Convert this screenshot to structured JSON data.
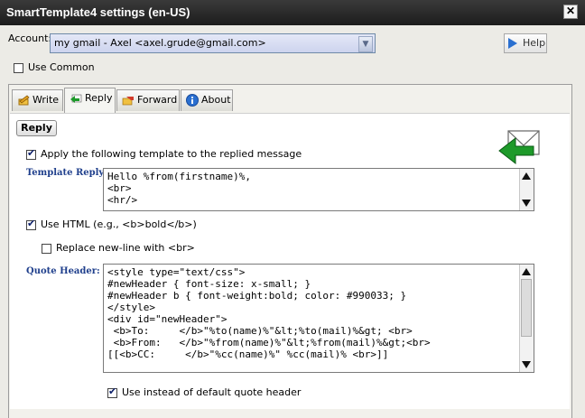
{
  "window": {
    "title": "SmartTemplate4 settings (en-US)",
    "close_glyph": "✕"
  },
  "account": {
    "label": "Account:",
    "selected": "my gmail - Axel <axel.grude@gmail.com>"
  },
  "help_label": "Help",
  "use_common": {
    "label": "Use Common",
    "checked": false
  },
  "tabs": [
    {
      "label": "Write",
      "icon": "pencil-icon",
      "active": false
    },
    {
      "label": "Reply",
      "icon": "reply-arrow-icon",
      "active": true
    },
    {
      "label": "Forward",
      "icon": "forward-hand-icon",
      "active": false
    },
    {
      "label": "About",
      "icon": "info-icon",
      "active": false
    }
  ],
  "reply": {
    "section_button": "Reply",
    "apply_template": {
      "label": "Apply the following template to the replied message",
      "checked": true
    },
    "template_label": "Template Reply:",
    "template_text": "Hello %from(firstname)%,\n<br>\n<hr/>",
    "use_html": {
      "label": "Use HTML (e.g., <b>bold</b>)",
      "checked": true
    },
    "replace_newline": {
      "label": "Replace new-line with <br>",
      "checked": false
    },
    "quote_header_label": "Quote Header:",
    "quote_header_text": "<style type=\"text/css\">\n#newHeader { font-size: x-small; }\n#newHeader b { font-weight:bold; color: #990033; }\n</style>\n<div id=\"newHeader\">\n <b>To:     </b>\"%to(name)%\"&lt;%to(mail)%&gt; <br>\n <b>From:   </b>\"%from(name)%\"&lt;%from(mail)%&gt;<br>\n[[<b>CC:     </b>\"%cc(name)%\" %cc(mail)% <br>]]",
    "use_instead": {
      "label": "Use instead of default quote header",
      "checked": true
    }
  },
  "colors": {
    "title_bar": "#1c1c1c",
    "field_label": "#1f3f8c",
    "account_select_bg": "#cdd4ee",
    "reply_icon": "#1e9a2a"
  }
}
